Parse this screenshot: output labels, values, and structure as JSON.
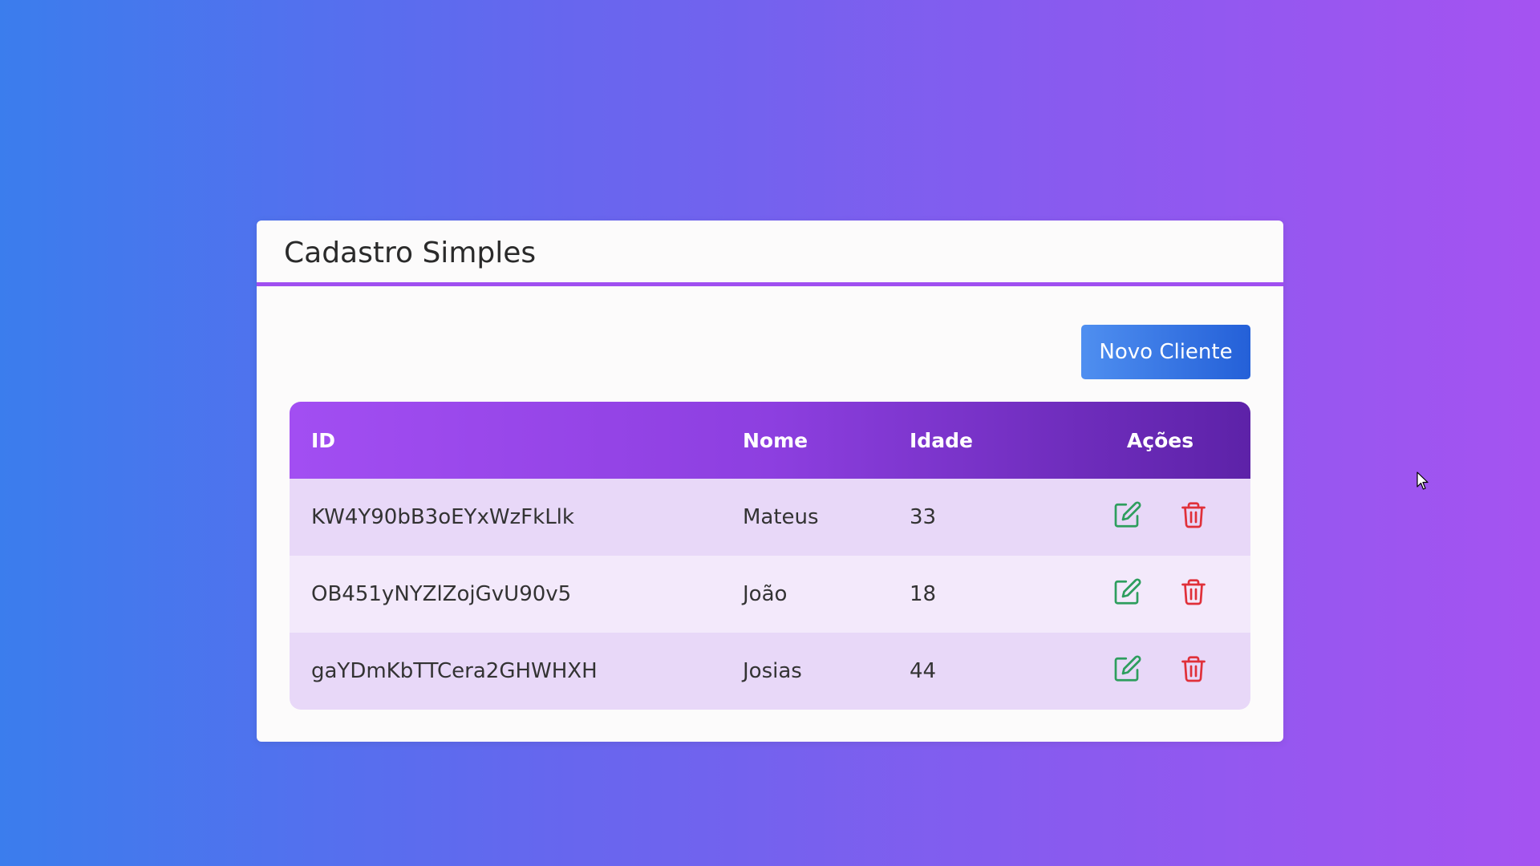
{
  "card": {
    "title": "Cadastro Simples"
  },
  "toolbar": {
    "new_client_label": "Novo Cliente"
  },
  "table": {
    "headers": {
      "id": "ID",
      "nome": "Nome",
      "idade": "Idade",
      "acoes": "Ações"
    },
    "rows": [
      {
        "id": "KW4Y90bB3oEYxWzFkLlk",
        "nome": "Mateus",
        "idade": "33"
      },
      {
        "id": "OB451yNYZlZojGvU90v5",
        "nome": "João",
        "idade": "18"
      },
      {
        "id": "gaYDmKbTTCera2GHWHXH",
        "nome": "Josias",
        "idade": "44"
      }
    ],
    "row_icons": {
      "edit": "edit-icon",
      "delete": "trash-icon"
    }
  },
  "colors": {
    "background_start": "#3b7ded",
    "background_end": "#a553f1",
    "header_accent": "#a04ff0",
    "table_header": "#8d3fe0",
    "button": "#2f6fe0",
    "edit_icon": "#2e9e5e",
    "delete_icon": "#e0303a"
  }
}
